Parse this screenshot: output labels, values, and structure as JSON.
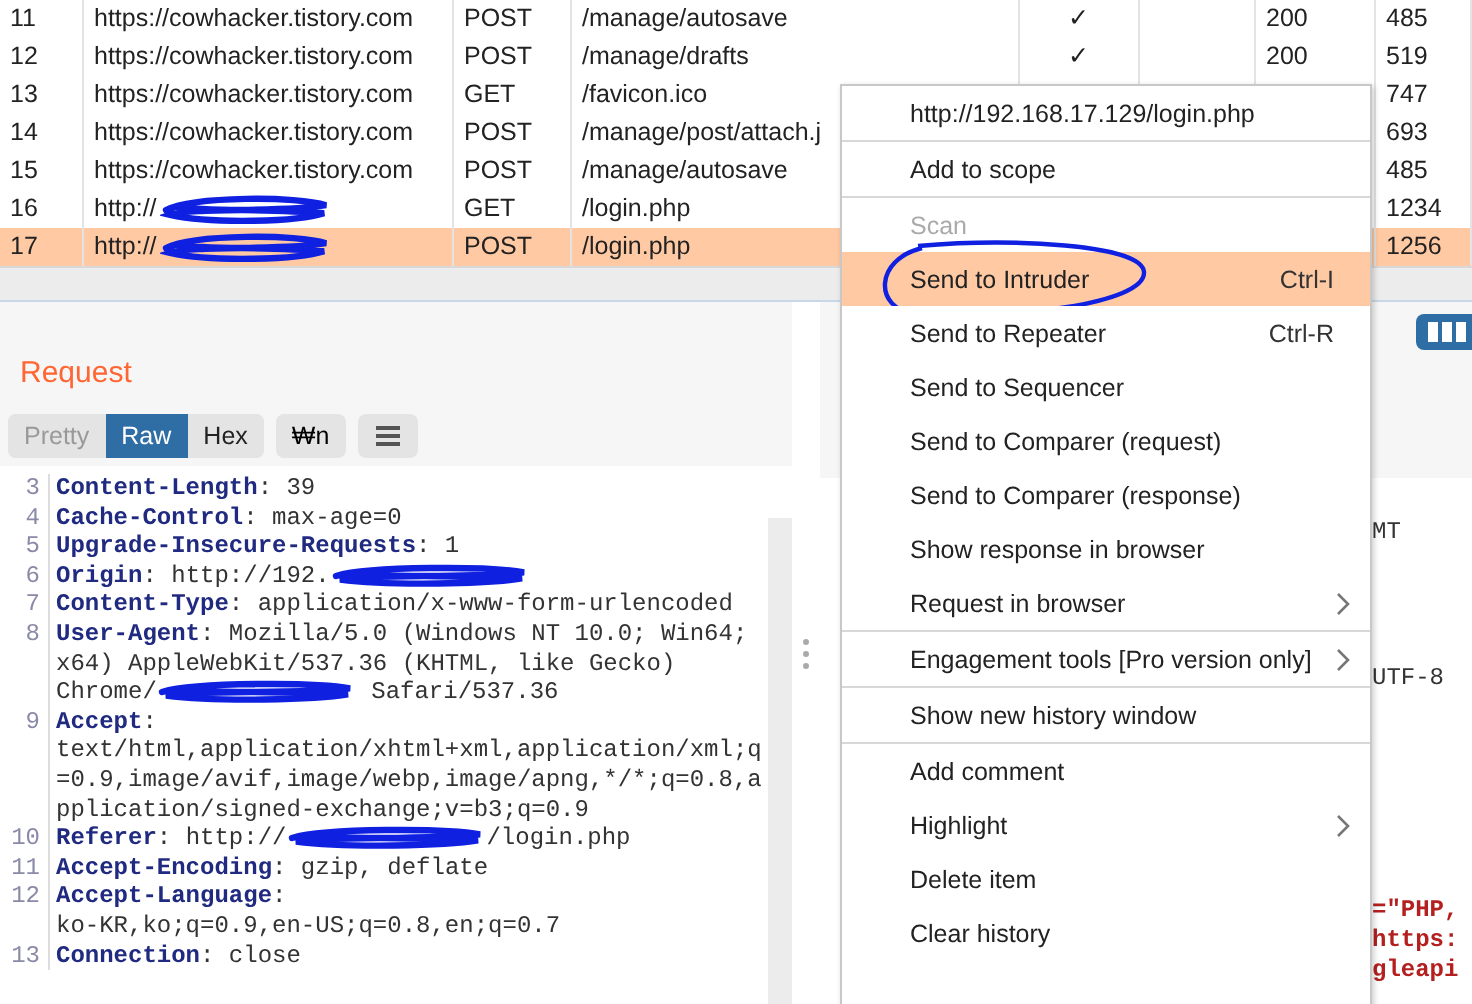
{
  "history": {
    "rows": [
      {
        "number": "11",
        "host": "https://cowhacker.tistory.com",
        "host_redacted": false,
        "method": "POST",
        "path": "/manage/autosave",
        "column_5": "✓",
        "status": "200",
        "length": "485",
        "selected": false
      },
      {
        "number": "12",
        "host": "https://cowhacker.tistory.com",
        "host_redacted": false,
        "method": "POST",
        "path": "/manage/drafts",
        "column_5": "✓",
        "status": "200",
        "length": "519",
        "selected": false
      },
      {
        "number": "13",
        "host": "https://cowhacker.tistory.com",
        "host_redacted": false,
        "method": "GET",
        "path": "/favicon.ico",
        "length": "747",
        "selected": false
      },
      {
        "number": "14",
        "host": "https://cowhacker.tistory.com",
        "host_redacted": false,
        "method": "POST",
        "path": "/manage/post/attach.j",
        "length": "693",
        "selected": false
      },
      {
        "number": "15",
        "host": "https://cowhacker.tistory.com",
        "host_redacted": false,
        "method": "POST",
        "path": "/manage/autosave",
        "length": "485",
        "selected": false
      },
      {
        "number": "16",
        "host": "http://",
        "host_redacted": true,
        "method": "GET",
        "path": "/login.php",
        "length": "1234",
        "selected": false
      },
      {
        "number": "17",
        "host": "http://",
        "host_redacted": true,
        "method": "POST",
        "path": "/login.php",
        "length": "1256",
        "selected": true
      }
    ]
  },
  "request": {
    "title": "Request",
    "tabs": [
      {
        "label": "Pretty",
        "selected": false,
        "disabled": true
      },
      {
        "label": "Raw",
        "selected": true,
        "disabled": false
      },
      {
        "label": "Hex",
        "selected": false,
        "disabled": false
      }
    ],
    "newline_button": "₩n",
    "lines": [
      {
        "number": "3",
        "parts": [
          {
            "kind": "name",
            "text": "Content-Length"
          },
          {
            "kind": "plain",
            "text": ": 39"
          }
        ]
      },
      {
        "number": "4",
        "parts": [
          {
            "kind": "name",
            "text": "Cache-Control"
          },
          {
            "kind": "plain",
            "text": ": max-age=0"
          }
        ]
      },
      {
        "number": "5",
        "parts": [
          {
            "kind": "name",
            "text": "Upgrade-Insecure-Requests"
          },
          {
            "kind": "plain",
            "text": ": 1"
          }
        ]
      },
      {
        "number": "6",
        "parts": [
          {
            "kind": "name",
            "text": "Origin"
          },
          {
            "kind": "plain",
            "text": ": http://192."
          },
          {
            "kind": "redaction"
          }
        ]
      },
      {
        "number": "7",
        "parts": [
          {
            "kind": "name",
            "text": "Content-Type"
          },
          {
            "kind": "plain",
            "text": ": application/x-www-form-urlencoded"
          }
        ]
      },
      {
        "number": "8",
        "parts": [
          {
            "kind": "name",
            "text": "User-Agent"
          },
          {
            "kind": "plain",
            "text": ": Mozilla/5.0 (Windows NT 10.0; Win64;"
          }
        ]
      },
      {
        "parts": [
          {
            "kind": "plain",
            "text": "x64) AppleWebKit/537.36 (KHTML, like Gecko)"
          }
        ]
      },
      {
        "parts": [
          {
            "kind": "plain",
            "text": "Chrome/"
          },
          {
            "kind": "redaction"
          },
          {
            "kind": "plain",
            "text": " Safari/537.36"
          }
        ]
      },
      {
        "number": "9",
        "parts": [
          {
            "kind": "name",
            "text": "Accept"
          },
          {
            "kind": "plain",
            "text": ":"
          }
        ]
      },
      {
        "parts": [
          {
            "kind": "plain",
            "text": "text/html,application/xhtml+xml,application/xml;q"
          }
        ]
      },
      {
        "parts": [
          {
            "kind": "plain",
            "text": "=0.9,image/avif,image/webp,image/apng,*/*;q=0.8,a"
          }
        ]
      },
      {
        "parts": [
          {
            "kind": "plain",
            "text": "pplication/signed-exchange;v=b3;q=0.9"
          }
        ]
      },
      {
        "number": "10",
        "parts": [
          {
            "kind": "name",
            "text": "Referer"
          },
          {
            "kind": "plain",
            "text": ": http://"
          },
          {
            "kind": "redaction"
          },
          {
            "kind": "plain",
            "text": "/login.php"
          }
        ]
      },
      {
        "number": "11",
        "parts": [
          {
            "kind": "name",
            "text": "Accept-Encoding"
          },
          {
            "kind": "plain",
            "text": ": gzip, deflate"
          }
        ]
      },
      {
        "number": "12",
        "parts": [
          {
            "kind": "name",
            "text": "Accept-Language"
          },
          {
            "kind": "plain",
            "text": ":"
          }
        ]
      },
      {
        "parts": [
          {
            "kind": "plain",
            "text": "ko-KR,ko;q=0.9,en-US;q=0.8,en;q=0.7"
          }
        ]
      },
      {
        "number": "13",
        "parts": [
          {
            "kind": "name",
            "text": "Connection"
          },
          {
            "kind": "plain",
            "text": ": close"
          }
        ]
      }
    ]
  },
  "response": {
    "fragments": [
      {
        "kind": "plain",
        "text": "MT"
      },
      {
        "kind": "plain",
        "text": "UTF-8"
      },
      {
        "kind": "string",
        "text": "=\"PHP,"
      },
      {
        "kind": "string",
        "text": "https:"
      },
      {
        "kind": "string",
        "text": "gleapi"
      }
    ]
  },
  "context_menu": {
    "items": [
      {
        "kind": "item",
        "label": "http://192.168.17.129/login.php",
        "disabled": false,
        "selected": false,
        "submenu": false,
        "circled": false
      },
      {
        "kind": "separator"
      },
      {
        "kind": "item",
        "label": "Add to scope",
        "disabled": false,
        "selected": false,
        "submenu": false,
        "circled": false
      },
      {
        "kind": "separator"
      },
      {
        "kind": "item",
        "label": "Scan",
        "disabled": true,
        "selected": false,
        "submenu": false,
        "circled": false
      },
      {
        "kind": "item",
        "label": "Send to Intruder",
        "shortcut": "Ctrl-I",
        "disabled": false,
        "selected": true,
        "submenu": false,
        "circled": true
      },
      {
        "kind": "item",
        "label": "Send to Repeater",
        "shortcut": "Ctrl-R",
        "disabled": false,
        "selected": false,
        "submenu": false,
        "circled": false
      },
      {
        "kind": "item",
        "label": "Send to Sequencer",
        "disabled": false,
        "selected": false,
        "submenu": false,
        "circled": false
      },
      {
        "kind": "item",
        "label": "Send to Comparer (request)",
        "disabled": false,
        "selected": false,
        "submenu": false,
        "circled": false
      },
      {
        "kind": "item",
        "label": "Send to Comparer (response)",
        "disabled": false,
        "selected": false,
        "submenu": false,
        "circled": false
      },
      {
        "kind": "item",
        "label": "Show response in browser",
        "disabled": false,
        "selected": false,
        "submenu": false,
        "circled": false
      },
      {
        "kind": "item",
        "label": "Request in browser",
        "disabled": false,
        "selected": false,
        "submenu": true,
        "circled": false
      },
      {
        "kind": "separator"
      },
      {
        "kind": "item",
        "label": "Engagement tools [Pro version only]",
        "disabled": false,
        "selected": false,
        "submenu": true,
        "circled": false
      },
      {
        "kind": "separator"
      },
      {
        "kind": "item",
        "label": "Show new history window",
        "disabled": false,
        "selected": false,
        "submenu": false,
        "circled": false
      },
      {
        "kind": "separator"
      },
      {
        "kind": "item",
        "label": "Add comment",
        "disabled": false,
        "selected": false,
        "submenu": false,
        "circled": false
      },
      {
        "kind": "item",
        "label": "Highlight",
        "disabled": false,
        "selected": false,
        "submenu": true,
        "circled": false
      },
      {
        "kind": "item",
        "label": "Delete item",
        "disabled": false,
        "selected": false,
        "submenu": false,
        "circled": false
      },
      {
        "kind": "item",
        "label": "Clear history",
        "disabled": false,
        "selected": false,
        "submenu": false,
        "circled": false
      }
    ]
  }
}
